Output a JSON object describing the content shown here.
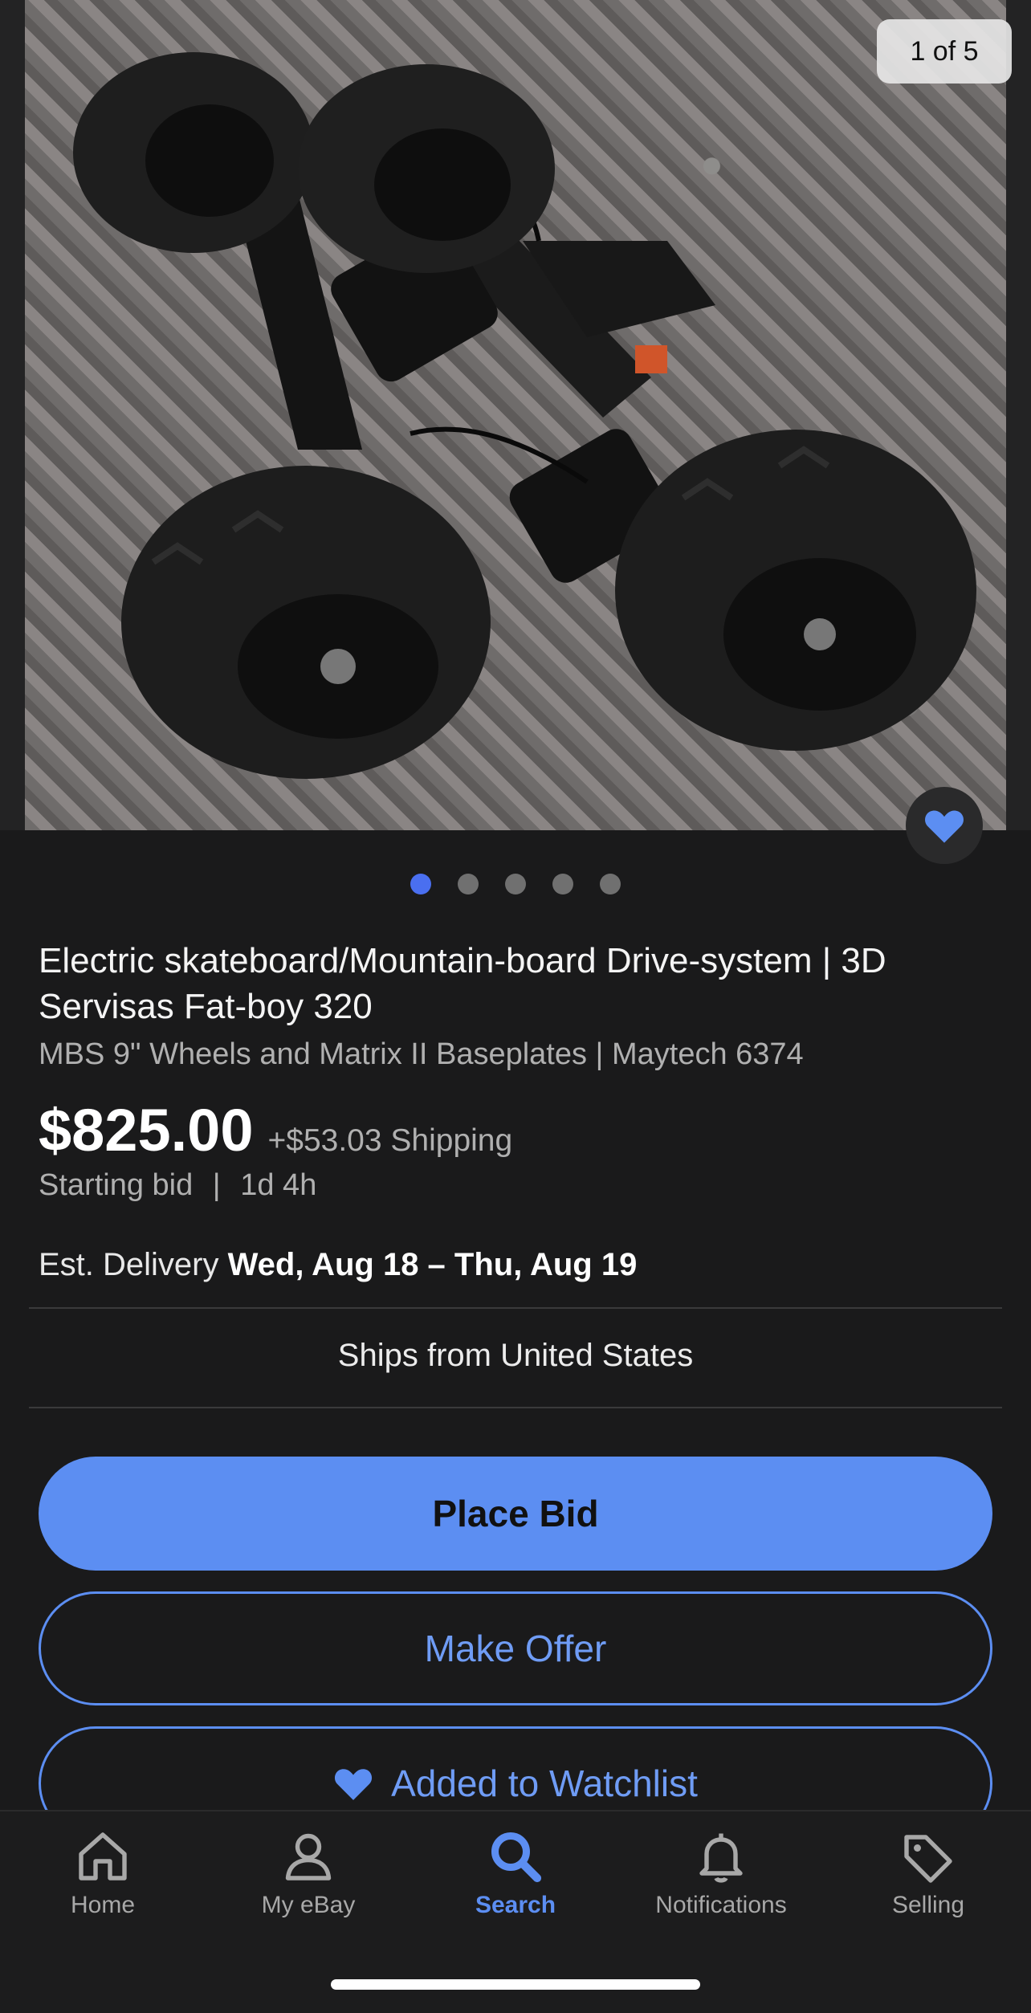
{
  "gallery": {
    "counter": "1 of 5",
    "image_count": 5,
    "active_index": 0,
    "image_alt_icon": "product-photo"
  },
  "listing": {
    "title": "Electric skateboard/Mountain-board Drive-system | 3D Servisas Fat-boy 320",
    "subtitle": "MBS 9\" Wheels and Matrix II Baseplates | Maytech 6374",
    "price": "$825.00",
    "shipping": "+$53.03 Shipping",
    "bid_type": "Starting bid",
    "separator": "|",
    "time_left": "1d 4h",
    "delivery_label": "Est. Delivery",
    "delivery_dates": "Wed, Aug 18 – Thu, Aug 19",
    "ships_from": "Ships from United States"
  },
  "actions": {
    "place_bid": "Place Bid",
    "make_offer": "Make Offer",
    "watchlist": "Added to Watchlist"
  },
  "nav": {
    "items": [
      {
        "label": "Home",
        "icon": "home-icon"
      },
      {
        "label": "My eBay",
        "icon": "user-icon"
      },
      {
        "label": "Search",
        "icon": "search-icon"
      },
      {
        "label": "Notifications",
        "icon": "bell-icon"
      },
      {
        "label": "Selling",
        "icon": "tag-icon"
      }
    ],
    "active": "Search"
  },
  "colors": {
    "accent": "#5c8ef2",
    "background": "#1a1a1b",
    "dot_active": "#4a6ff0"
  }
}
